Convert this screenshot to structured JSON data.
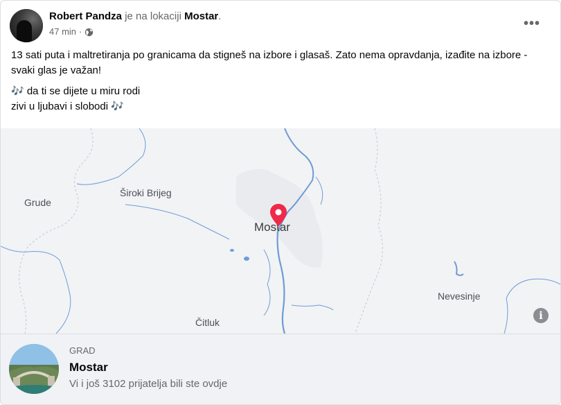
{
  "post": {
    "author": "Robert Pandza",
    "location_prefix": "je na lokaciji",
    "location": "Mostar",
    "location_suffix": ".",
    "time": "47 min",
    "separator": "·",
    "privacy_icon": "globe-icon",
    "more_label": "•••",
    "text": {
      "line1": "13 sati puta i maltretiranja po granicama da stigneš na izbore i glasaš. Zato nema opravdanja, izađite na izbore - svaki glas je važan!",
      "line2": "🎶 da ti se dijete u miru rodi",
      "line3": "zivi u ljubavi i slobodi 🎶"
    }
  },
  "map": {
    "labels": {
      "grude": "Grude",
      "siroki": "Široki Brijeg",
      "mostar": "Mostar",
      "nevesinje": "Nevesinje",
      "citluk": "Čitluk"
    },
    "pin_color": "#f02849",
    "info_label": "i"
  },
  "place": {
    "category": "GRAD",
    "name": "Mostar",
    "subtitle": "Vi i još 3102 prijatelja bili ste ovdje"
  }
}
